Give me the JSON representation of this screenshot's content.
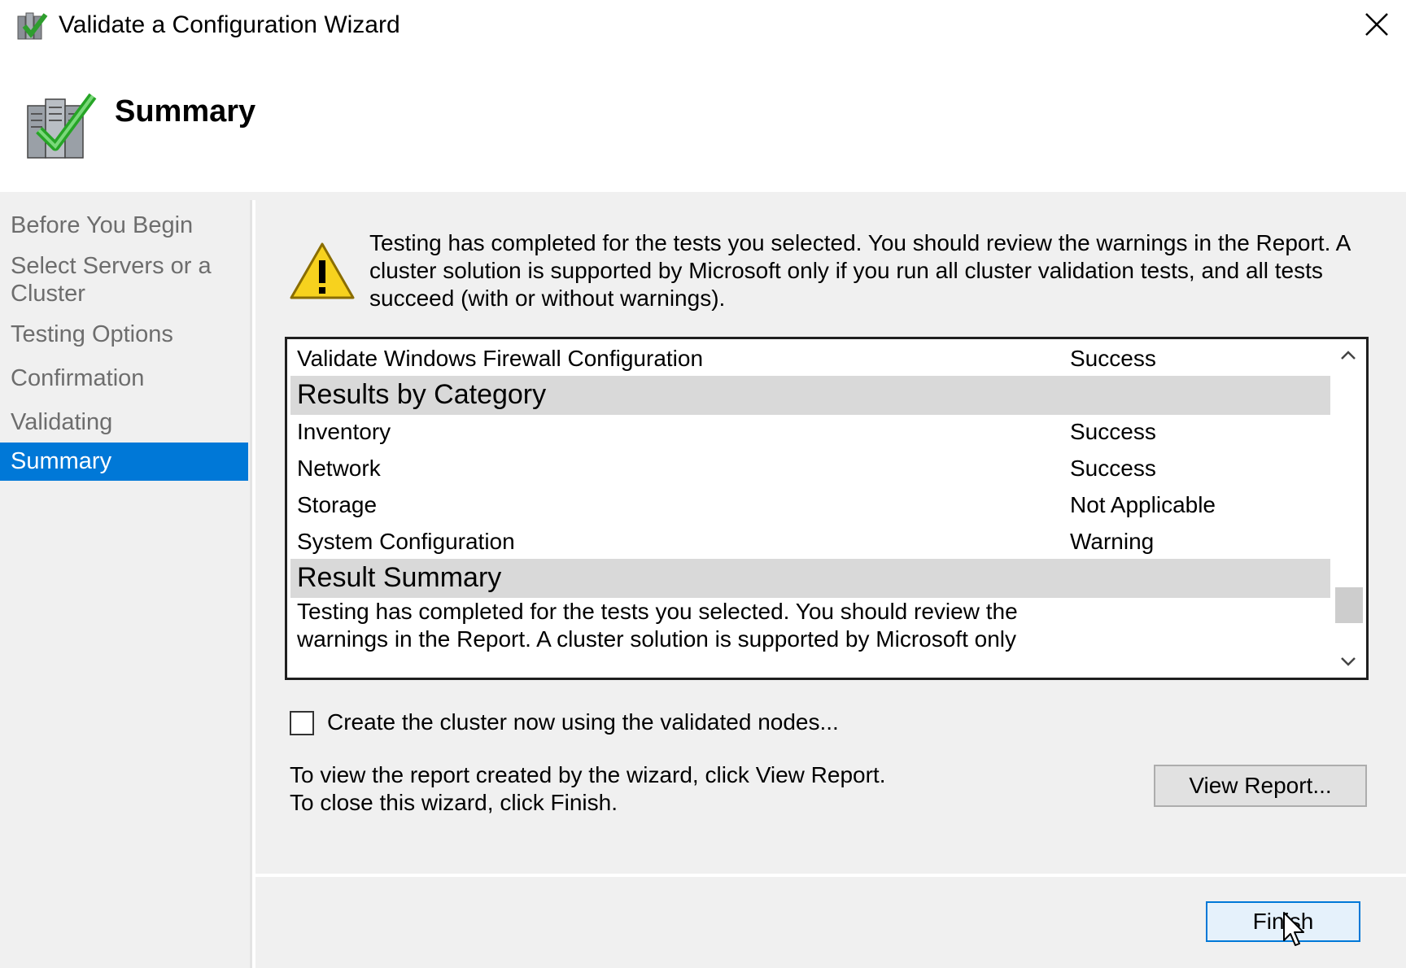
{
  "window": {
    "title": "Validate a Configuration Wizard",
    "app_icon": "cluster-validate-icon",
    "close_icon": "close-icon"
  },
  "header": {
    "title": "Summary",
    "icon": "server-check-icon"
  },
  "sidebar": {
    "items": [
      {
        "label": "Before You Begin",
        "active": false
      },
      {
        "label": "Select Servers or a Cluster",
        "active": false
      },
      {
        "label": "Testing Options",
        "active": false
      },
      {
        "label": "Confirmation",
        "active": false
      },
      {
        "label": "Validating",
        "active": false
      },
      {
        "label": "Summary",
        "active": true
      }
    ],
    "active_color": "#0078d7"
  },
  "main": {
    "warning_icon": "warning-icon",
    "warning_text": "Testing has completed for the tests you selected. You should review the warnings in the Report.  A cluster solution is supported by Microsoft only if you run all cluster validation tests, and all tests succeed (with or without warnings).",
    "results": {
      "top_row": {
        "name": "Validate Windows Firewall Configuration",
        "status": "Success"
      },
      "category_header": "Results by Category",
      "categories": [
        {
          "name": "Inventory",
          "status": "Success"
        },
        {
          "name": "Network",
          "status": "Success"
        },
        {
          "name": "Storage",
          "status": "Not Applicable"
        },
        {
          "name": "System Configuration",
          "status": "Warning"
        }
      ],
      "summary_header": "Result Summary",
      "summary_text": "Testing has completed for the tests you selected. You should review the warnings in the Report.  A cluster solution is supported by Microsoft only"
    },
    "checkbox": {
      "label": "Create the cluster now using the validated nodes...",
      "checked": false
    },
    "info_line1": "To view the report created by the wizard, click View Report.",
    "info_line2": "To close this wizard, click Finish.",
    "view_report_label": "View Report..."
  },
  "footer": {
    "finish_label": "Finish"
  }
}
